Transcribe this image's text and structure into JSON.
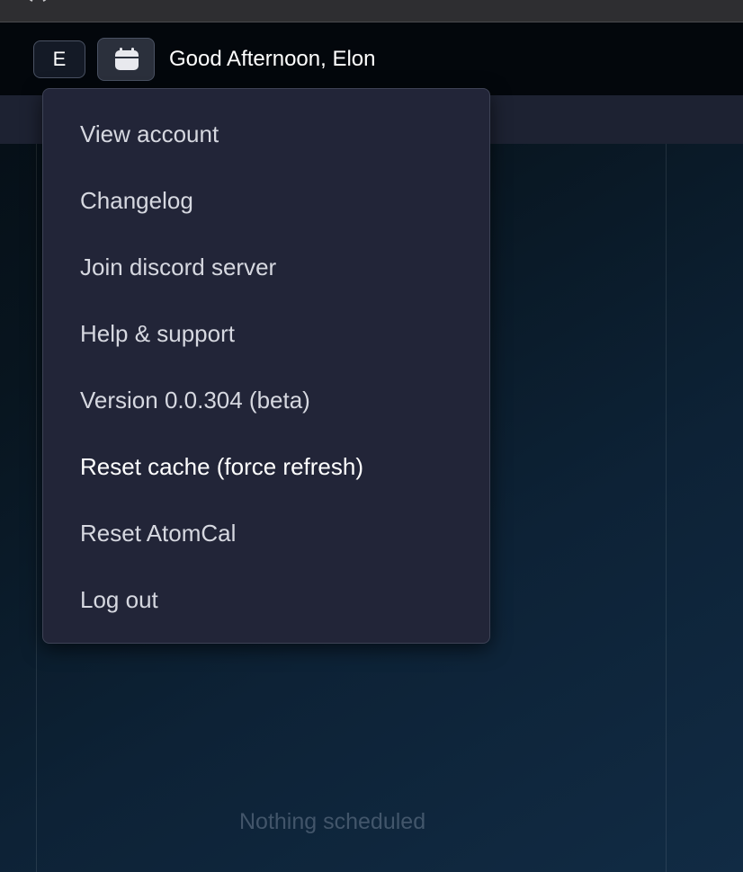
{
  "titlebar": {
    "icon": "window-glyph-icon"
  },
  "header": {
    "avatar_letter": "E",
    "calendar_icon": "calendar-icon",
    "greeting": "Good Afternoon, Elon"
  },
  "menu": {
    "items": [
      {
        "label": "View account"
      },
      {
        "label": "Changelog"
      },
      {
        "label": "Join discord server"
      },
      {
        "label": "Help & support"
      },
      {
        "label": "Version 0.0.304 (beta)"
      },
      {
        "label": "Reset cache (force refresh)"
      },
      {
        "label": "Reset AtomCal"
      },
      {
        "label": "Log out"
      }
    ]
  },
  "main": {
    "empty_state": "Nothing scheduled"
  },
  "colors": {
    "menu_bg": "#222538",
    "menu_text": "#d6d8e0",
    "highlight_text": "#ffffff",
    "topbar_bg": "#03070c"
  }
}
